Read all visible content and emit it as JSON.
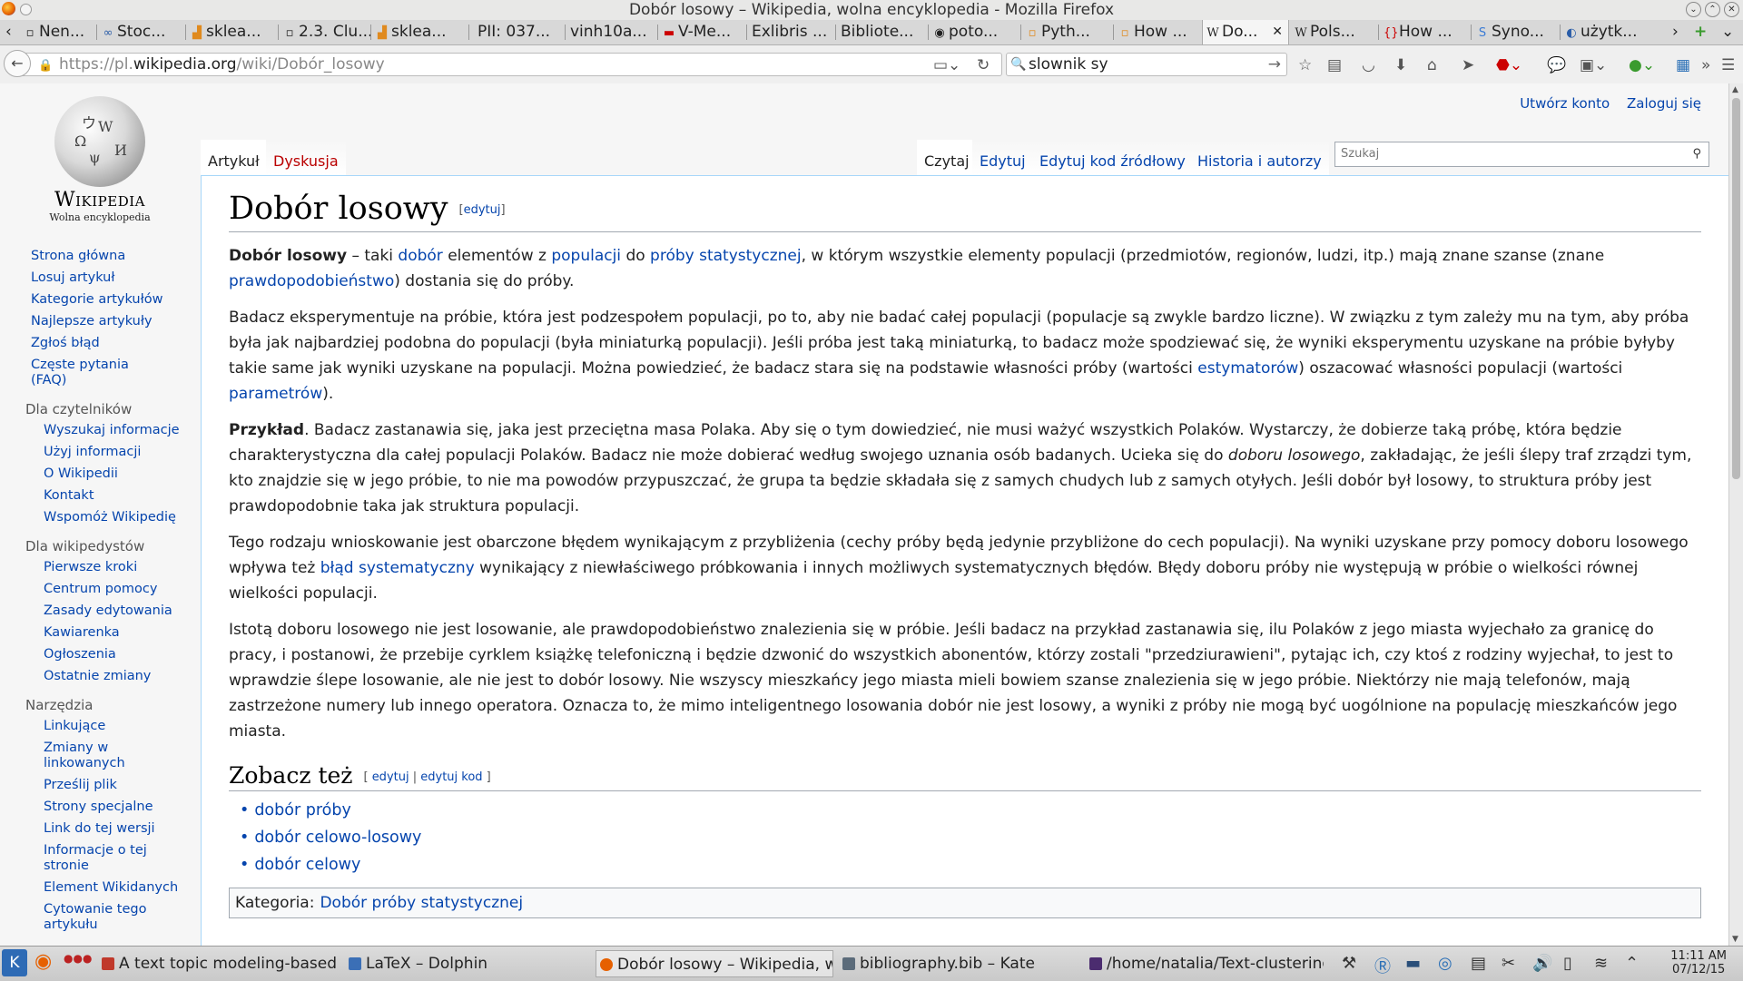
{
  "window": {
    "title": "Dobór losowy – Wikipedia, wolna encyklopedia - Mozilla Firefox"
  },
  "tabs": [
    {
      "label": "Nen...",
      "icon": "page-icon"
    },
    {
      "label": "Stoc...",
      "icon": "link-icon"
    },
    {
      "label": "sklea...",
      "icon": "chart-icon"
    },
    {
      "label": "2.3. Clu...",
      "icon": "page-icon"
    },
    {
      "label": "sklea...",
      "icon": "chart-icon"
    },
    {
      "label": "PII: 037...",
      "icon": ""
    },
    {
      "label": "vinh10a...",
      "icon": ""
    },
    {
      "label": "V-Me...",
      "icon": "video-icon"
    },
    {
      "label": "Exlibris ...",
      "icon": ""
    },
    {
      "label": "Bibliote...",
      "icon": ""
    },
    {
      "label": "poto...",
      "icon": "github-icon"
    },
    {
      "label": "Pyth...",
      "icon": "page-icon"
    },
    {
      "label": "How ...",
      "icon": "page-icon"
    },
    {
      "label": "Do...",
      "icon": "wikipedia-icon",
      "active": true
    },
    {
      "label": "Pols...",
      "icon": "wikipedia-icon"
    },
    {
      "label": "How ...",
      "icon": "braces-icon"
    },
    {
      "label": "Syno...",
      "icon": "s-icon"
    },
    {
      "label": "użytk...",
      "icon": "page-icon"
    }
  ],
  "navbar": {
    "url_scheme": "https://pl.",
    "url_host": "wikipedia.org",
    "url_path": "/wiki/Dobór_losowy",
    "search_value": "slownik sy"
  },
  "wiki": {
    "wordmark": "Wikipedia",
    "tagline": "Wolna encyklopedia",
    "personal": {
      "create_account": "Utwórz konto",
      "login": "Zaloguj się"
    },
    "tabs": {
      "article": "Artykuł",
      "discussion": "Dyskusja",
      "read": "Czytaj",
      "edit": "Edytuj",
      "edit_source": "Edytuj kod źródłowy",
      "history": "Historia i autorzy"
    },
    "search_placeholder": "Szukaj",
    "nav_main": [
      "Strona główna",
      "Losuj artykuł",
      "Kategorie artykułów",
      "Najlepsze artykuły",
      "Zgłoś błąd",
      "Częste pytania (FAQ)"
    ],
    "readers_heading": "Dla czytelników",
    "nav_readers": [
      "Wyszukaj informacje",
      "Użyj informacji",
      "O Wikipedii",
      "Kontakt",
      "Wspomóż Wikipedię"
    ],
    "editors_heading": "Dla wikipedystów",
    "nav_editors": [
      "Pierwsze kroki",
      "Centrum pomocy",
      "Zasady edytowania",
      "Kawiarenka",
      "Ogłoszenia",
      "Ostatnie zmiany"
    ],
    "tools_heading": "Narzędzia",
    "nav_tools": [
      "Linkujące",
      "Zmiany w linkowanych",
      "Prześlij plik",
      "Strony specjalne",
      "Link do tej wersji",
      "Informacje o tej stronie",
      "Element Wikidanych",
      "Cytowanie tego artykułu"
    ]
  },
  "article": {
    "title": "Dobór losowy",
    "edit_label": "edytuj",
    "edit_code_label": "edytuj kod",
    "p1": {
      "bold": "Dobór losowy",
      "t1": " – taki ",
      "l1": "dobór",
      "t2": " elementów z ",
      "l2": "populacji",
      "t3": " do ",
      "l3": "próby statystycznej",
      "t4": ", w którym wszystkie elementy populacji (przedmiotów, regionów, ludzi, itp.) mają znane szanse (znane ",
      "l4": "prawdopodobieństwo",
      "t5": ") dostania się do próby."
    },
    "p2": {
      "t1": "Badacz eksperymentuje na próbie, która jest podzespołem populacji, po to, aby nie badać całej populacji (populacje są zwykle bardzo liczne). W związku z tym zależy mu na tym, aby próba była jak najbardziej podobna do populacji (była miniaturką populacji). Jeśli próba jest taką miniaturką, to badacz może spodziewać się, że wyniki eksperymentu uzyskane na próbie byłyby takie same jak wyniki uzyskane na populacji. Można powiedzieć, że badacz stara się na podstawie własności próby (wartości ",
      "l1": "estymatorów",
      "t2": ") oszacować własności populacji (wartości ",
      "l2": "parametrów",
      "t3": ")."
    },
    "p3": {
      "bold": "Przykład",
      "t1": ". Badacz zastanawia się, jaka jest przeciętna masa Polaka. Aby się o tym dowiedzieć, nie musi ważyć wszystkich Polaków. Wystarczy, że dobierze taką próbę, która będzie charakterystyczna dla całej populacji Polaków. Badacz nie może dobierać według swojego uznania osób badanych. Ucieka się do ",
      "italic": "doboru losowego",
      "t2": ", zakładając, że jeśli ślepy traf zrządzi tym, kto znajdzie się w jego próbie, to nie ma powodów przypuszczać, że grupa ta będzie składała się z samych chudych lub z samych otyłych. Jeśli dobór był losowy, to struktura próby jest prawdopodobnie taka jak struktura populacji."
    },
    "p4": {
      "t1": "Tego rodzaju wnioskowanie jest obarczone błędem wynikającym z przybliżenia (cechy próby będą jedynie przybliżone do cech populacji). Na wyniki uzyskane przy pomocy doboru losowego wpływa też ",
      "l1": "błąd systematyczny",
      "t2": " wynikający z niewłaściwego próbkowania i innych możliwych systematycznych błędów. Błędy doboru próby nie występują w próbie o wielkości równej wielkości populacji."
    },
    "p5": "Istotą doboru losowego nie jest losowanie, ale prawdopodobieństwo znalezienia się w próbie. Jeśli badacz na przykład zastanawia się, ilu Polaków z jego miasta wyjechało za granicę do pracy, i postanowi, że przebije cyrklem książkę telefoniczną i będzie dzwonić do wszystkich abonentów, którzy zostali \"przedziurawieni\", pytając ich, czy ktoś z rodziny wyjechał, to jest to wprawdzie ślepe losowanie, ale nie jest to dobór losowy. Nie wszyscy mieszkańcy jego miasta mieli bowiem szanse znalezienia się w jego próbie. Niektórzy nie mają telefonów, mają zastrzeżone numery lub innego operatora. Oznacza to, że mimo inteligentnego losowania dobór nie jest losowy, a wyniki z próby nie mogą być uogólnione na populację mieszkańców jego miasta.",
    "see_also_title": "Zobacz też",
    "see_also": [
      "dobór próby",
      "dobór celowo-losowy",
      "dobór celowy"
    ],
    "category_label": "Kategoria",
    "category": "Dobór próby statystycznej"
  },
  "taskbar": {
    "items": [
      {
        "label": "A text topic modeling-based",
        "color": "#c0392b"
      },
      {
        "label": "LaTeX – Dolphin",
        "color": "#3b6fb6"
      },
      {
        "label": "Dobór losowy – Wikipedia, wo",
        "color": "#e66000",
        "active": true
      },
      {
        "label": "bibliography.bib – Kate",
        "color": "#5b6b7a"
      },
      {
        "label": "/home/natalia/Text-clustering",
        "color": "#4b2c6f"
      }
    ],
    "clock_time": "11:11 AM",
    "clock_date": "07/12/15"
  }
}
